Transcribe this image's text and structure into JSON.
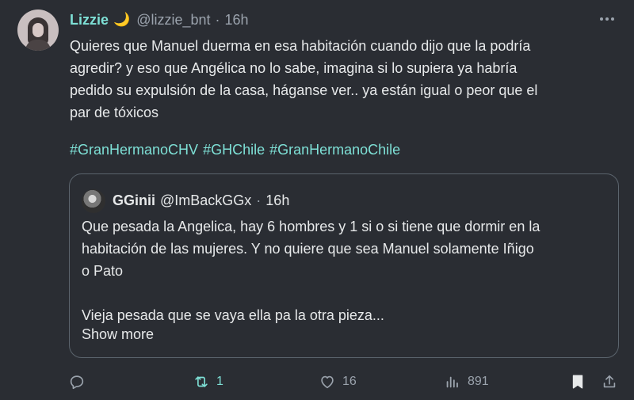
{
  "tweet": {
    "display_name": "Lizzie",
    "name_emoji": "🌙",
    "handle": "@lizzie_bnt",
    "separator": "·",
    "time": "16h",
    "more_icon": "more-horizontal-icon",
    "text": "Quieres que Manuel duerma en esa habitación cuando dijo que la podría\nagredir? y eso que Angélica no lo sabe, imagina si lo supiera ya habría\npedido su expulsión de la casa, háganse ver.. ya están igual o peor que el\npar de tóxicos",
    "hashtags": [
      "#GranHermanoCHV",
      "#GHChile",
      "#GranHermanoChile"
    ]
  },
  "quote": {
    "display_name": "GGinii",
    "handle": "@ImBackGGx",
    "separator": "·",
    "time": "16h",
    "text": "Que pesada la Angelica, hay 6 hombres y 1 si o si tiene que dormir en la\nhabitación de las mujeres. Y no quiere que sea Manuel solamente Iñigo\no Pato\n\nVieja pesada que se vaya ella pa la otra pieza...",
    "show_more": "Show more"
  },
  "actions": {
    "reply_count": "",
    "retweet_count": "1",
    "like_count": "16",
    "views_count": "891"
  },
  "colors": {
    "background": "#2a2d33",
    "accent": "#7ee0d6",
    "muted": "#9ba3ad",
    "text": "#e7e9ea",
    "border": "#5b646d"
  }
}
